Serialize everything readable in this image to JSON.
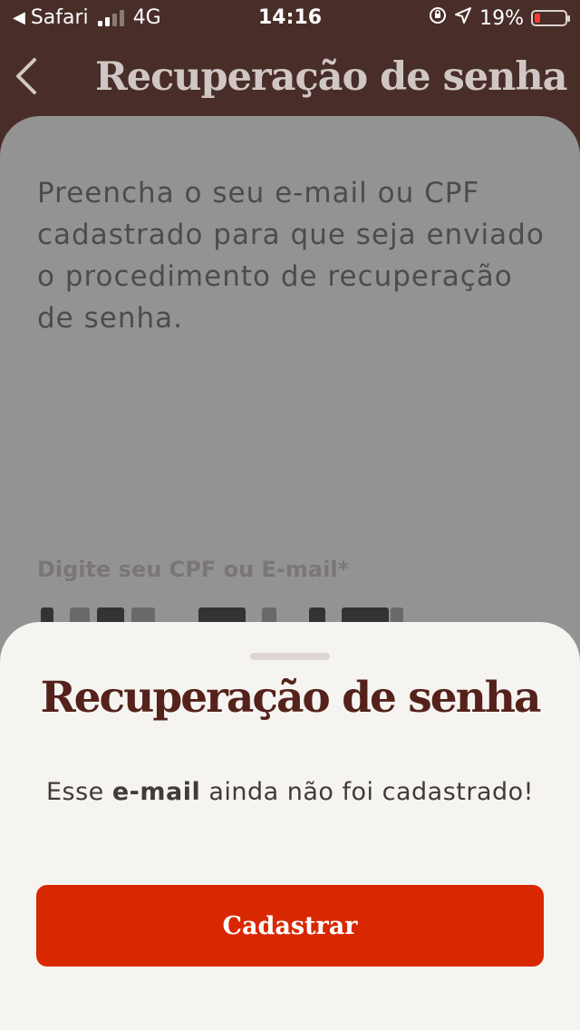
{
  "status_bar": {
    "back_app": "Safari",
    "network": "4G",
    "time": "14:16",
    "battery_percent": "19%",
    "battery_level": 0.19,
    "icons": [
      "back-arrow-icon",
      "signal-icon",
      "orientation-lock-icon",
      "location-icon",
      "battery-icon"
    ]
  },
  "header": {
    "title": "Recuperação de senha",
    "back_icon": "chevron-left-icon"
  },
  "form": {
    "description": "Preencha o seu e-mail ou CPF cadastrado para que seja enviado o procedimento de recuperação de senha.",
    "field_label": "Digite seu CPF ou E-mail*"
  },
  "sheet": {
    "title": "Recuperação de senha",
    "message_prefix": "Esse ",
    "message_bold": "e-mail",
    "message_suffix": " ainda não foi cadastrado!",
    "button_label": "Cadastrar"
  },
  "colors": {
    "header_bg": "#482d28",
    "overlay_card": "#949393",
    "sheet_bg": "#f6f4f1",
    "title_brown": "#54221b",
    "button_red": "#d82801"
  }
}
